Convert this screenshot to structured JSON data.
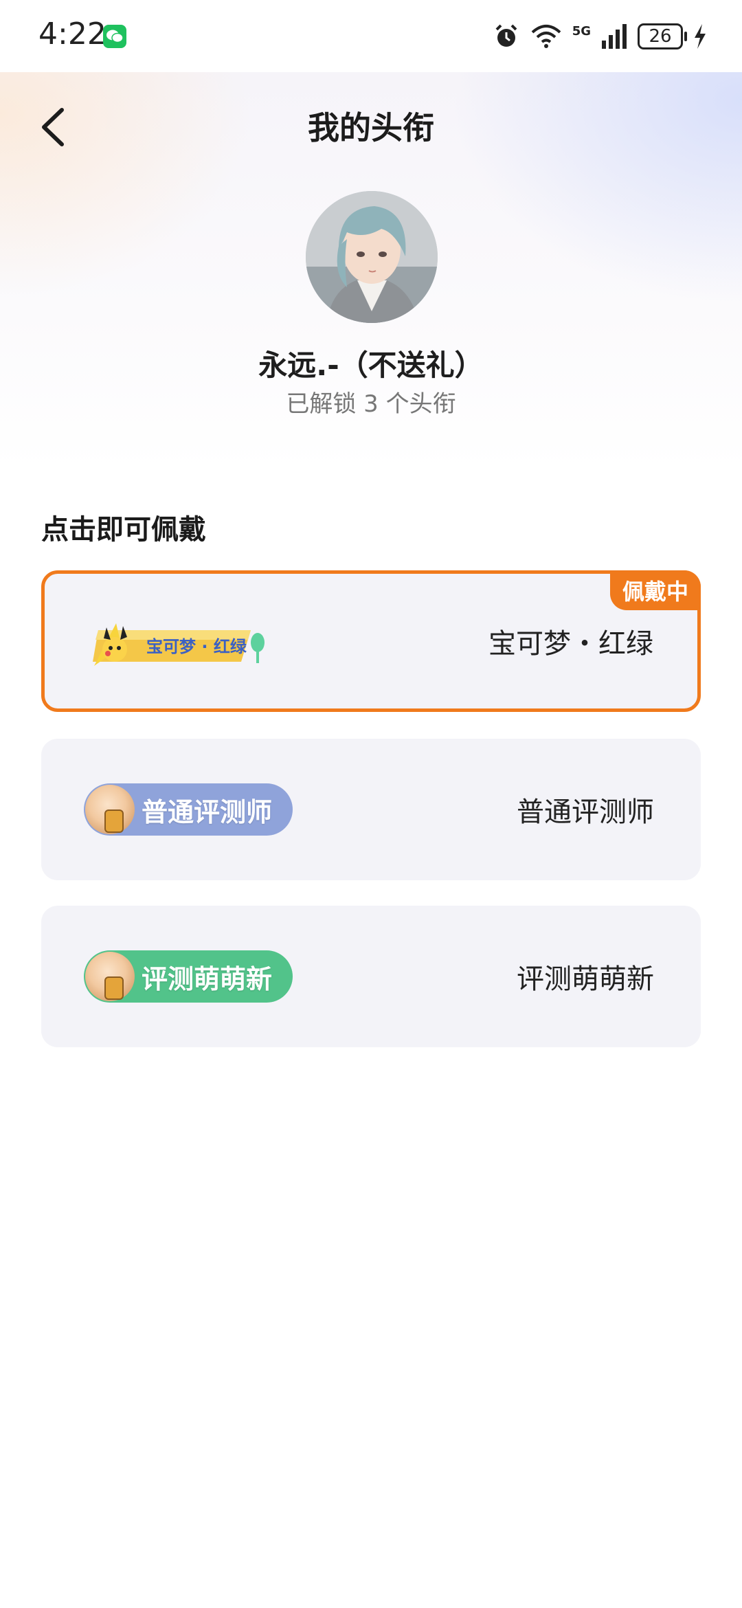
{
  "status_bar": {
    "time": "4:22",
    "network": "5G",
    "battery": "26"
  },
  "header": {
    "title": "我的头衔"
  },
  "profile": {
    "username": "永远.-（不送礼）",
    "unlocked_text": "已解锁 3 个头衔"
  },
  "section": {
    "title": "点击即可佩戴"
  },
  "titles": [
    {
      "name": "宝可梦・红绿",
      "badge_text": "宝可梦・红绿",
      "active": true,
      "active_label": "佩戴中"
    },
    {
      "name": "普通评测师",
      "badge_text": "普通评测师",
      "active": false
    },
    {
      "name": "评测萌萌新",
      "badge_text": "评测萌萌新",
      "active": false
    }
  ],
  "colors": {
    "accent": "#f07a1c",
    "badge_blue": "#8fa3da",
    "badge_green": "#52c38a",
    "card_bg": "#f3f3f8"
  }
}
